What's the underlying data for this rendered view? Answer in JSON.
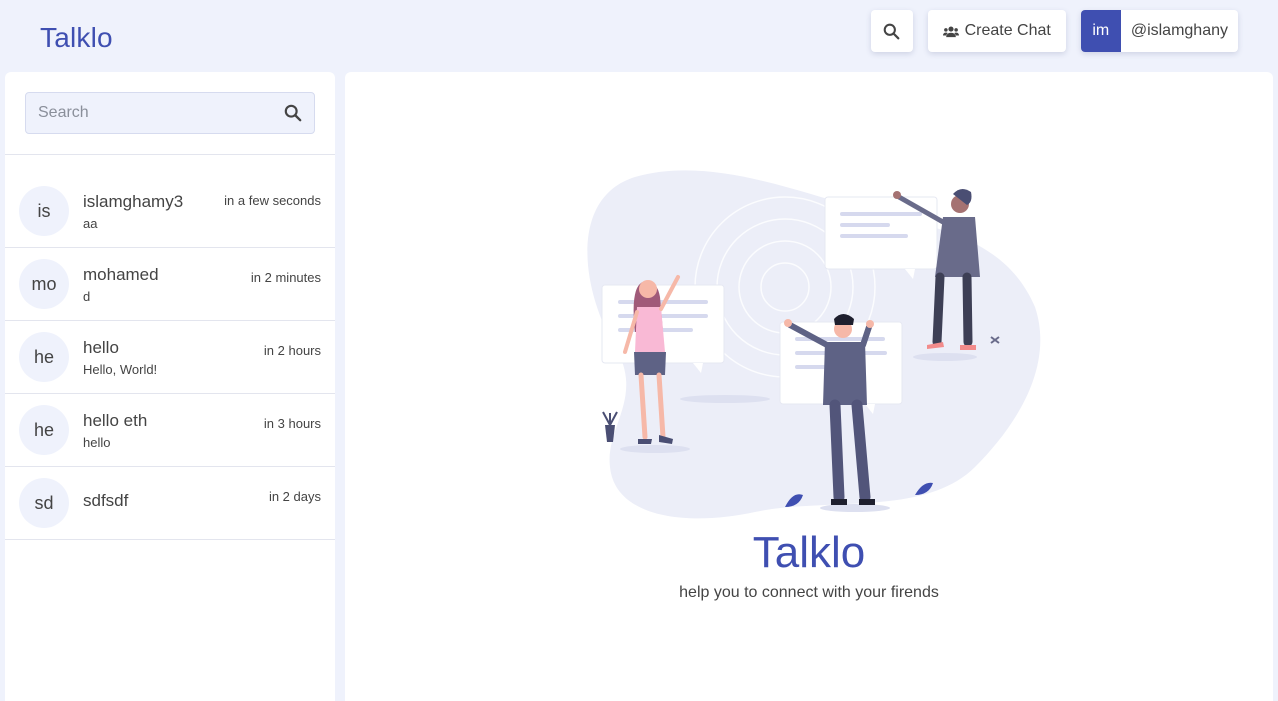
{
  "app": {
    "logo": "Talklo"
  },
  "header": {
    "create_chat_label": "Create Chat",
    "user_initials": "im",
    "user_handle": "@islamghany"
  },
  "sidebar": {
    "search_placeholder": "Search",
    "chats": [
      {
        "initials": "is",
        "name": "islamghamy3",
        "last_message": "aa",
        "time": "in a few seconds"
      },
      {
        "initials": "mo",
        "name": "mohamed",
        "last_message": "d",
        "time": "in 2 minutes"
      },
      {
        "initials": "he",
        "name": "hello",
        "last_message": "Hello, World!",
        "time": "in 2 hours"
      },
      {
        "initials": "he",
        "name": "hello eth",
        "last_message": "hello",
        "time": "in 3 hours"
      },
      {
        "initials": "sd",
        "name": "sdfsdf",
        "last_message": "",
        "time": "in 2 days"
      }
    ]
  },
  "main": {
    "title": "Talklo",
    "subtitle": "help you to connect with your firends"
  },
  "colors": {
    "accent": "#3f4fb1",
    "background": "#eff2fc"
  }
}
